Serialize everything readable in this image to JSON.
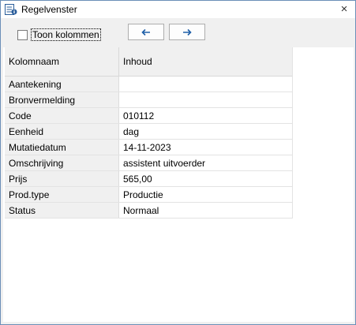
{
  "window": {
    "title": "Regelvenster",
    "close_glyph": "×"
  },
  "toolbar": {
    "toon_kolommen_label": "Toon kolommen",
    "toon_kolommen_checked": false,
    "prev_icon": "arrow-left-icon",
    "next_icon": "arrow-right-icon"
  },
  "grid": {
    "headers": [
      "Kolomnaam",
      "Inhoud"
    ],
    "rows": [
      {
        "name": "Aantekening",
        "value": ""
      },
      {
        "name": "Bronvermelding",
        "value": ""
      },
      {
        "name": "Code",
        "value": "010112"
      },
      {
        "name": "Eenheid",
        "value": "dag"
      },
      {
        "name": "Mutatiedatum",
        "value": "14-11-2023"
      },
      {
        "name": "Omschrijving",
        "value": "assistent uitvoerder"
      },
      {
        "name": "Prijs",
        "value": "565,00"
      },
      {
        "name": "Prod.type",
        "value": "Productie"
      },
      {
        "name": "Status",
        "value": "Normaal"
      }
    ]
  },
  "colors": {
    "arrow": "#1f5fa8",
    "window_border": "#6b8fb8"
  }
}
